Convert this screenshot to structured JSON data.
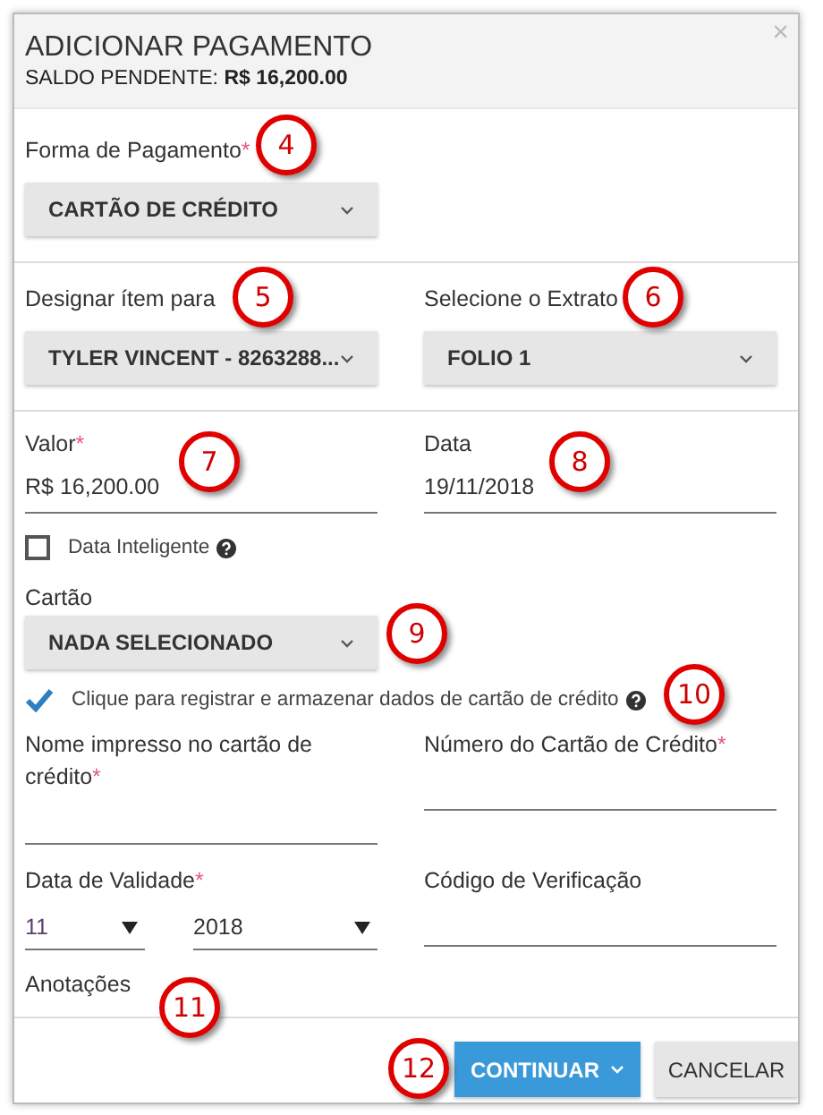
{
  "dialog": {
    "title": "ADICIONAR PAGAMENTO",
    "balance_label": "SALDO PENDENTE:",
    "balance_value": "R$ 16,200.00",
    "close": "×"
  },
  "payment_method": {
    "label": "Forma de Pagamento",
    "required_mark": "*",
    "value": "CARTÃO DE CRÉDITO"
  },
  "assign_to": {
    "label": "Designar ítem para",
    "value": "TYLER VINCENT - 8263288..."
  },
  "statement": {
    "label": "Selecione o Extrato",
    "value": "FOLIO 1"
  },
  "amount": {
    "label": "Valor",
    "required_mark": "*",
    "value": "R$ 16,200.00"
  },
  "date": {
    "label": "Data",
    "value": "19/11/2018"
  },
  "smart_date": {
    "label": "Data Inteligente",
    "checked": false
  },
  "card": {
    "label": "Cartão",
    "value": "NADA SELECIONADO"
  },
  "save_card": {
    "label": "Clique para registrar e armazenar dados de cartão de crédito",
    "checked": true
  },
  "name_on_card": {
    "label": "Nome impresso no cartão de crédito",
    "required_mark": "*"
  },
  "card_number": {
    "label": "Número do Cartão de Crédito",
    "required_mark": "*"
  },
  "expiry": {
    "label": "Data de Validade",
    "required_mark": "*",
    "month": "11",
    "year": "2018"
  },
  "cvv": {
    "label": "Código de Verificação"
  },
  "notes": {
    "label": "Anotações"
  },
  "buttons": [
    {
      "label": "CONTINUAR",
      "kind": "primary"
    },
    {
      "label": "CANCELAR",
      "kind": "secondary"
    }
  ],
  "callouts": [
    {
      "label": "4"
    },
    {
      "label": "5"
    },
    {
      "label": "6"
    },
    {
      "label": "7"
    },
    {
      "label": "8"
    },
    {
      "label": "9"
    },
    {
      "label": "10"
    },
    {
      "label": "11"
    },
    {
      "label": "12"
    }
  ]
}
